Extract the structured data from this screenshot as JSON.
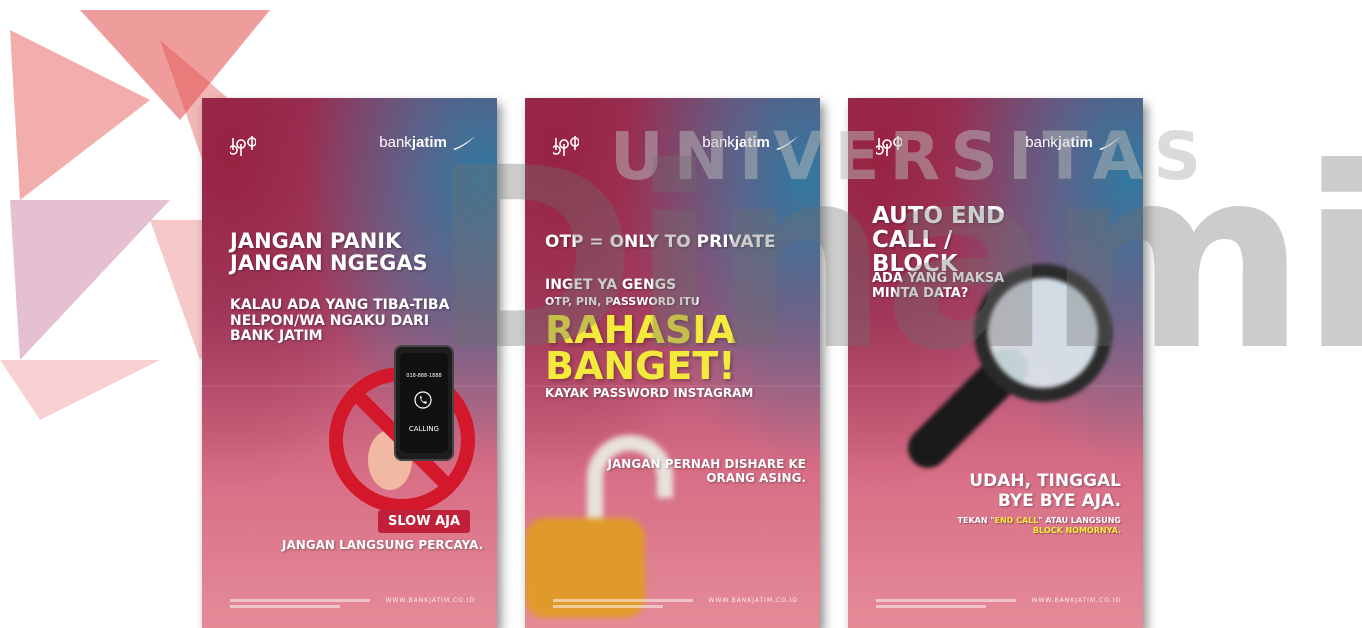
{
  "top_caption": "",
  "watermark": {
    "small": "UNIVERSITAS",
    "big": "Dinamika"
  },
  "posters": [
    {
      "bank_prefix": "bank",
      "bank_name": "jatim",
      "headline": "JANGAN PANIK JANGAN NGEGAS",
      "sub": "KALAU ADA YANG TIBA-TIBA NELPON/WA NGAKU DARI BANK JATIM",
      "phone_number": "018-888-1888",
      "phone_calling": "CALLING",
      "badge": "SLOW AJA",
      "bottom": "JANGAN LANGSUNG PERCAYA.",
      "footer_url": "WWW.BANKJATIM.CO.ID"
    },
    {
      "bank_prefix": "bank",
      "bank_name": "jatim",
      "headline": "OTP = ONLY TO PRIVATE",
      "sub1": "INGET YA GENGS",
      "sub2": "OTP, PIN, PASSWORD ITU",
      "rahasia": "RAHASIA BANGET!",
      "small": "KAYAK PASSWORD INSTAGRAM",
      "right": "JANGAN PERNAH DISHARE KE ORANG ASING.",
      "footer_url": "WWW.BANKJATIM.CO.ID"
    },
    {
      "bank_prefix": "bank",
      "bank_name": "jatim",
      "headline": "AUTO END CALL / BLOCK",
      "sub": "ADA YANG MAKSA MINTA DATA?",
      "right": "UDAH, TINGGAL BYE BYE AJA.",
      "tekan_pre": "TEKAN \"",
      "tekan_hl": "END CALL",
      "tekan_mid": "\" ATAU LANGSUNG",
      "tekan_hl2": "BLOCK NOMORNYA.",
      "footer_url": "WWW.BANKJATIM.CO.ID"
    }
  ],
  "colors": {
    "highlight": "#f4ea3c",
    "badge": "#c0203a"
  }
}
